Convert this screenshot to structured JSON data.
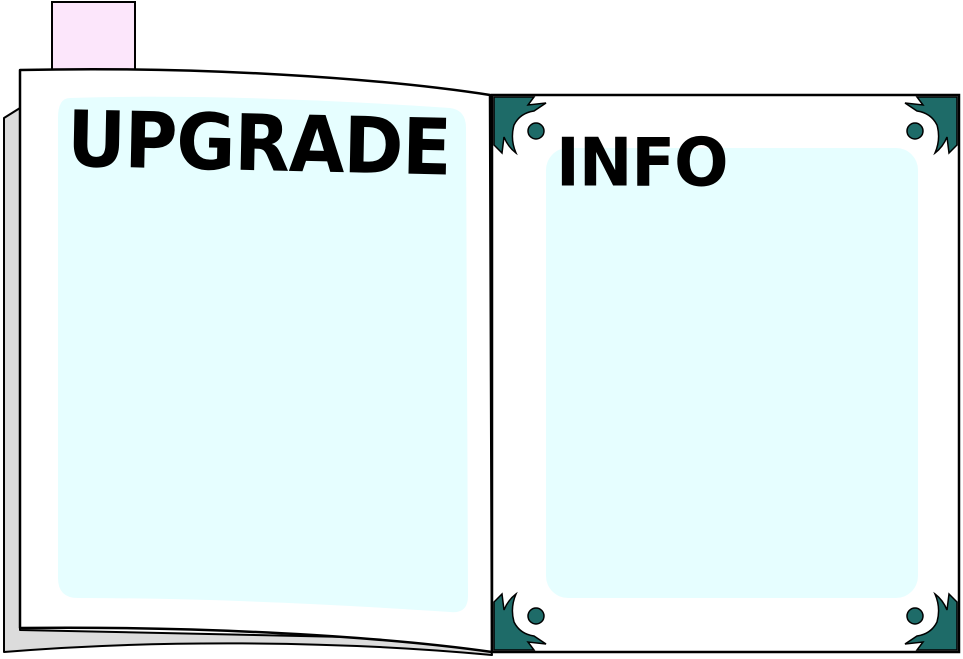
{
  "book": {
    "left_page": {
      "title": "UPGRADE"
    },
    "right_page": {
      "title": "INFO"
    },
    "bookmark_tab": {
      "color": "#fce6fb"
    },
    "colors": {
      "page_fill": "#ffffff",
      "content_panel": "#e6feff",
      "page_shadow": "#dcdcdc",
      "corner_ornament": "#1e6b68",
      "outline": "#000000"
    },
    "corner_ornaments": [
      "top-left",
      "top-right",
      "bottom-left",
      "bottom-right"
    ]
  }
}
